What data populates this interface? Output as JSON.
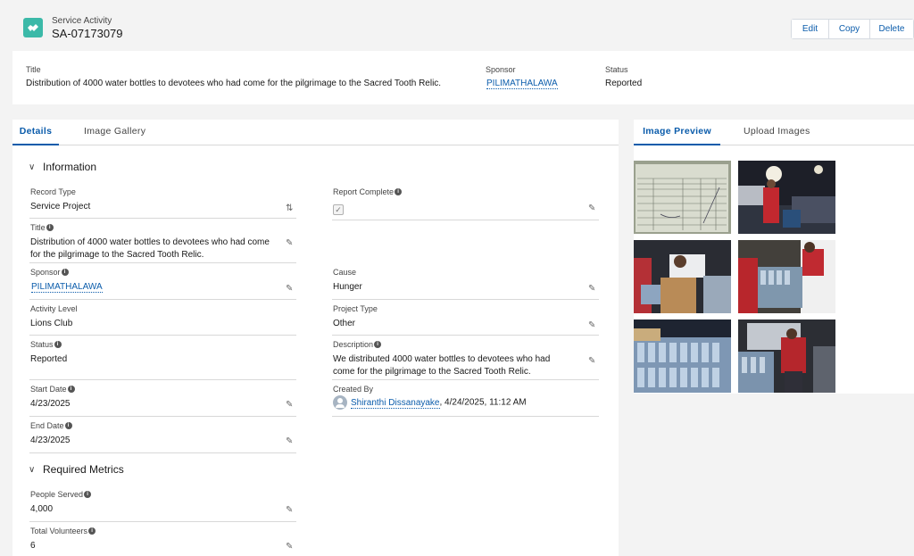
{
  "header": {
    "object_type": "Service Activity",
    "record_name": "SA-07173079",
    "icon": "handshake-icon",
    "buttons": {
      "edit": "Edit",
      "copy": "Copy",
      "delete": "Delete"
    }
  },
  "highlights": {
    "title_label": "Title",
    "title_value": "Distribution of 4000 water bottles to devotees who had come for the pilgrimage to the Sacred Tooth Relic.",
    "sponsor_label": "Sponsor",
    "sponsor_value": "PILIMATHALAWA",
    "status_label": "Status",
    "status_value": "Reported"
  },
  "tabs": {
    "details": "Details",
    "gallery": "Image Gallery"
  },
  "sections": {
    "information": "Information",
    "metrics": "Required Metrics"
  },
  "fields": {
    "record_type": {
      "label": "Record Type",
      "value": "Service Project"
    },
    "title": {
      "label": "Title",
      "value": "Distribution of 4000 water bottles to devotees who had come for the pilgrimage to the Sacred Tooth Relic."
    },
    "sponsor": {
      "label": "Sponsor",
      "value": "PILIMATHALAWA"
    },
    "activity_level": {
      "label": "Activity Level",
      "value": "Lions Club"
    },
    "status": {
      "label": "Status",
      "value": "Reported"
    },
    "start_date": {
      "label": "Start Date",
      "value": "4/23/2025"
    },
    "end_date": {
      "label": "End Date",
      "value": "4/23/2025"
    },
    "report_complete": {
      "label": "Report Complete",
      "checked": true
    },
    "cause": {
      "label": "Cause",
      "value": "Hunger"
    },
    "project_type": {
      "label": "Project Type",
      "value": "Other"
    },
    "description": {
      "label": "Description",
      "value": "We distributed 4000 water bottles to devotees who had come for the pilgrimage to the Sacred Tooth Relic."
    },
    "created_by": {
      "label": "Created By",
      "user": "Shiranthi Dissanayake",
      "date": ", 4/24/2025, 11:12 AM"
    },
    "people_served": {
      "label": "People Served",
      "value": "4,000"
    },
    "total_volunteers": {
      "label": "Total Volunteers",
      "value": "6"
    }
  },
  "right_panel": {
    "tabs": {
      "preview": "Image Preview",
      "upload": "Upload Images"
    }
  },
  "colors": {
    "brand": "#0b5cab",
    "object_icon": "#3bb9a8"
  }
}
